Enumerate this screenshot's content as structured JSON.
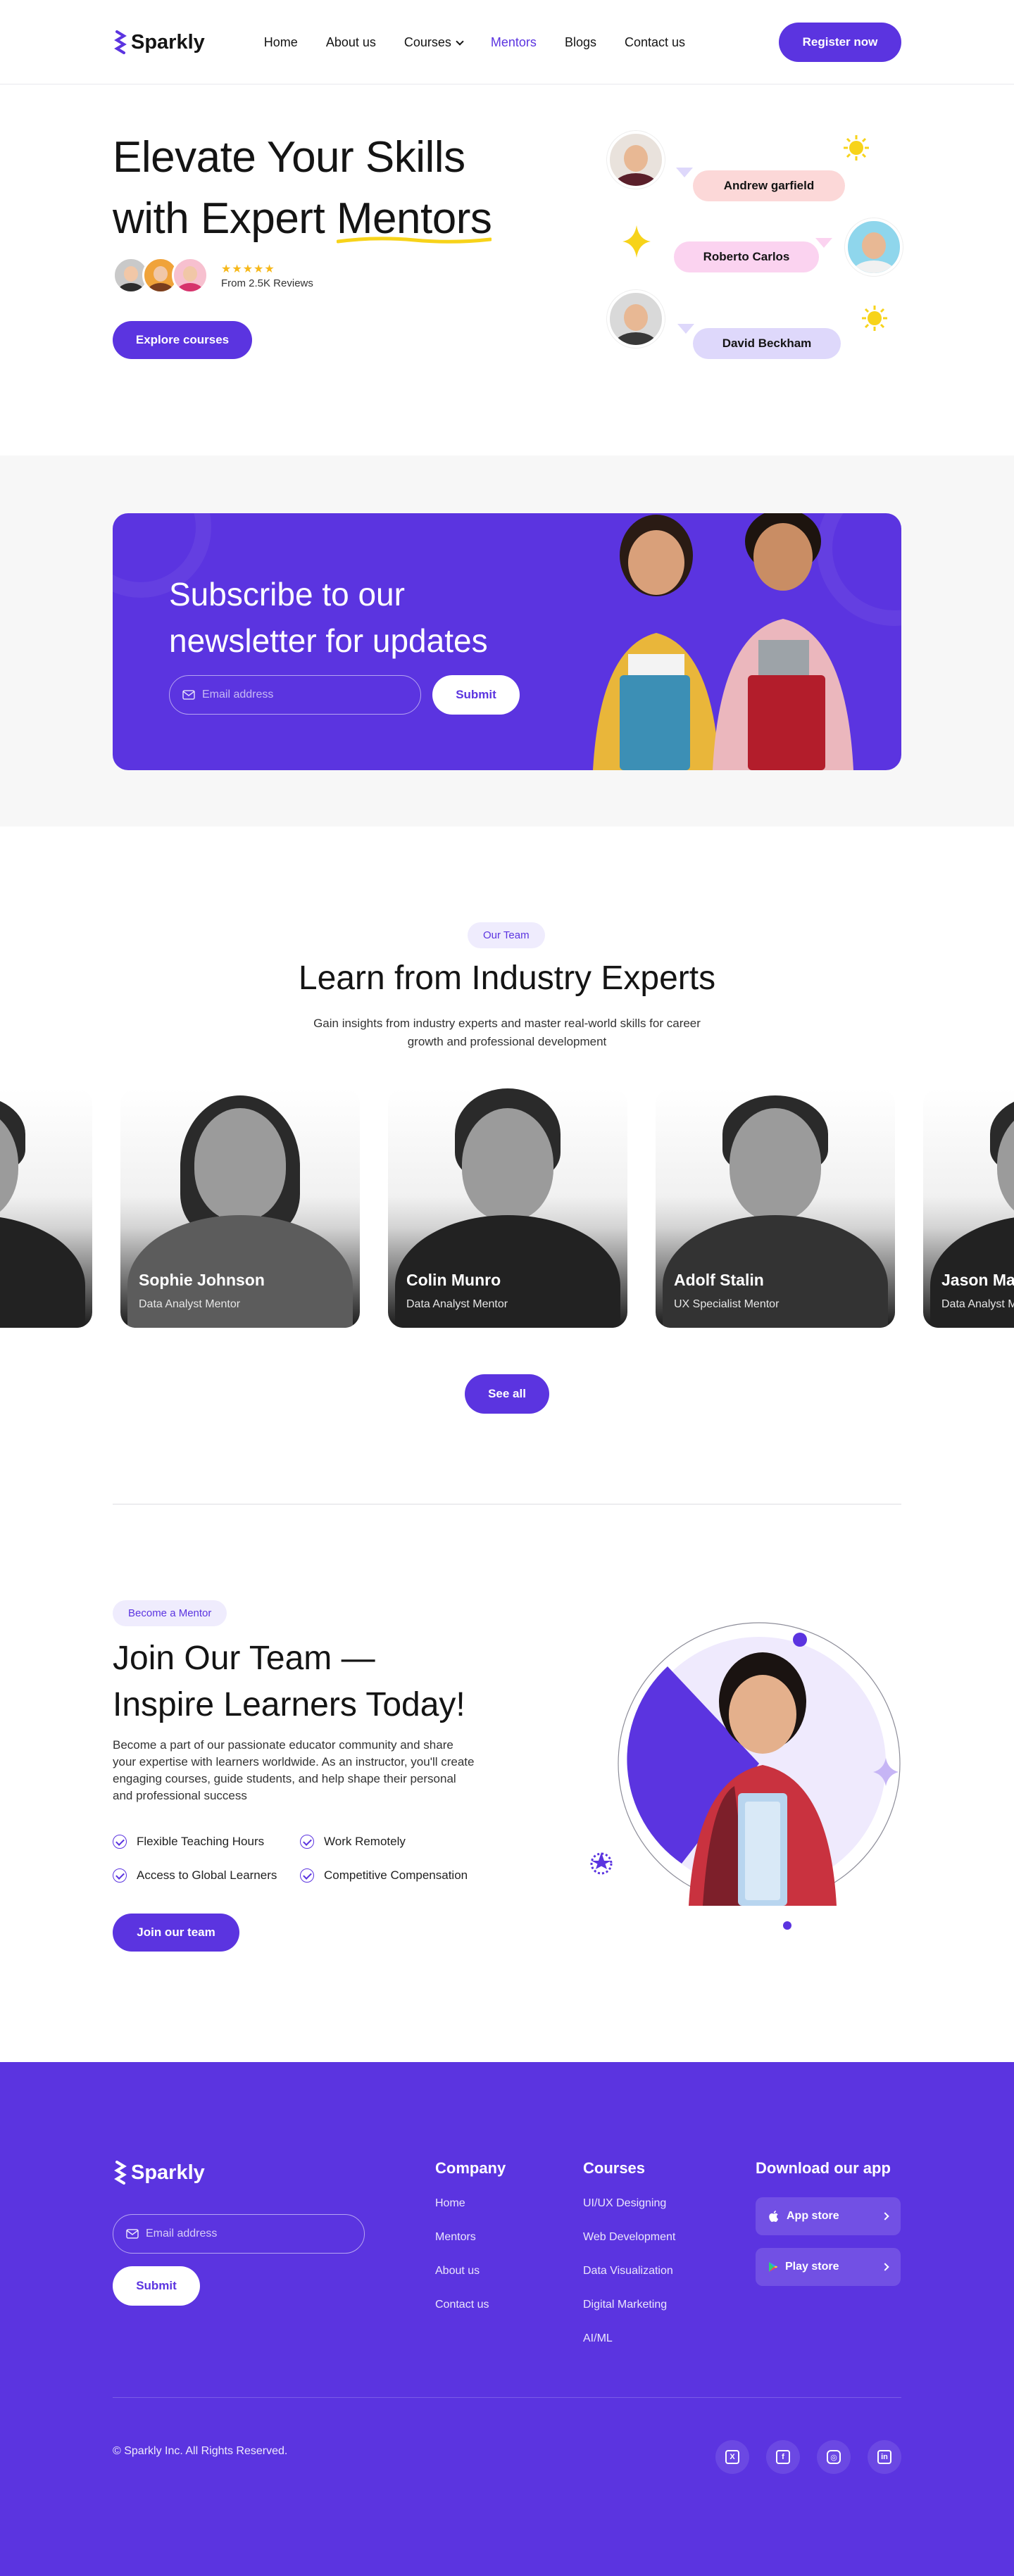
{
  "brand": {
    "name": "Sparkly",
    "accent": "#5b34e0"
  },
  "nav": {
    "links": [
      "Home",
      "About us",
      "Courses",
      "Mentors",
      "Blogs",
      "Contact us"
    ],
    "active": "Mentors",
    "register": "Register now"
  },
  "hero": {
    "title_line1": "Elevate Your Skills",
    "title_line2_prefix": "with Expert ",
    "title_highlight": "Mentors",
    "rating_stars": "★★★★★",
    "reviews": "From 2.5K Reviews",
    "cta": "Explore courses",
    "mentors": [
      "Andrew garfield",
      "Roberto Carlos",
      "David Beckham"
    ]
  },
  "newsletter": {
    "title_line1": "Subscribe to our",
    "title_line2": "newsletter for updates",
    "placeholder": "Email address",
    "submit": "Submit"
  },
  "team": {
    "pill": "Our Team",
    "title": "Learn from Industry Experts",
    "subtitle": "Gain insights from industry experts and master real-world skills for career growth and professional development",
    "cards": [
      {
        "name": "",
        "role": "r"
      },
      {
        "name": "Sophie Johnson",
        "role": "Data Analyst Mentor"
      },
      {
        "name": "Colin Munro",
        "role": "Data Analyst Mentor"
      },
      {
        "name": "Adolf Stalin",
        "role": "UX Specialist Mentor"
      },
      {
        "name": "Jason Ma",
        "role": "Data Analyst M"
      }
    ],
    "see_all": "See all"
  },
  "join": {
    "pill": "Become a Mentor",
    "title_line1": "Join Our Team —",
    "title_line2": "Inspire Learners Today!",
    "description": "Become a part of our passionate educator community and share your expertise with learners worldwide. As an instructor, you'll create engaging courses, guide students, and help shape their personal and professional success",
    "features": [
      "Flexible Teaching Hours",
      "Work Remotely",
      "Access to Global Learners",
      "Competitive Compensation"
    ],
    "cta": "Join our team"
  },
  "footer": {
    "placeholder": "Email address",
    "submit": "Submit",
    "company": {
      "heading": "Company",
      "links": [
        "Home",
        "Mentors",
        "About us",
        "Contact us"
      ]
    },
    "courses": {
      "heading": "Courses",
      "links": [
        "UI/UX Designing",
        "Web Development",
        "Data Visualization",
        "Digital Marketing",
        "AI/ML"
      ]
    },
    "app": {
      "heading": "Download our app",
      "stores": [
        "App store",
        "Play store"
      ]
    },
    "copyright": "© Sparkly Inc. All Rights Reserved.",
    "socials": [
      "x-icon",
      "facebook-icon",
      "instagram-icon",
      "linkedin-icon"
    ]
  }
}
